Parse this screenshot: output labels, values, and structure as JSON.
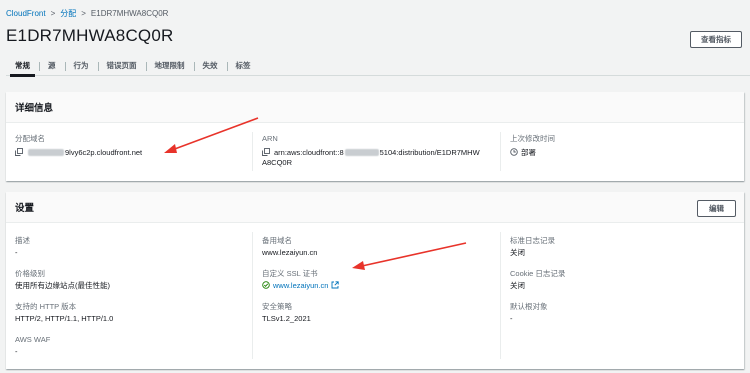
{
  "breadcrumb": {
    "root": "CloudFront",
    "section": "分配",
    "current": "E1DR7MHWA8CQ0R"
  },
  "page": {
    "title": "E1DR7MHWA8CQ0R",
    "metrics_button": "查看指标"
  },
  "tabs": [
    {
      "label": "常规",
      "active": true
    },
    {
      "label": "源"
    },
    {
      "label": "行为"
    },
    {
      "label": "错误页面"
    },
    {
      "label": "地理限制"
    },
    {
      "label": "失效"
    },
    {
      "label": "标签"
    }
  ],
  "details": {
    "title": "详细信息",
    "domain_label": "分配域名",
    "domain_value": "9lvy6c2p.cloudfront.net",
    "arn_label": "ARN",
    "arn_prefix": "arn:aws:cloudfront::8",
    "arn_suffix": "5104:distribution/E1DR7MHW",
    "arn_line2": "A8CQ0R",
    "modified_label": "上次修改时间",
    "modified_value": "部署"
  },
  "settings": {
    "title": "设置",
    "edit_button": "编辑",
    "description_label": "描述",
    "description_value": "-",
    "price_label": "价格级别",
    "price_value": "使用所有边缘站点(最佳性能)",
    "http_label": "支持的 HTTP 版本",
    "http_value": "HTTP/2, HTTP/1.1, HTTP/1.0",
    "waf_label": "AWS WAF",
    "waf_value": "-",
    "alt_domain_label": "备用域名",
    "alt_domain_value": "www.lezaiyun.cn",
    "ssl_label": "自定义 SSL 证书",
    "ssl_value": "www.lezaiyun.cn",
    "policy_label": "安全策略",
    "policy_value": "TLSv1.2_2021",
    "std_log_label": "标准日志记录",
    "std_log_value": "关闭",
    "cookie_log_label": "Cookie 日志记录",
    "cookie_log_value": "关闭",
    "default_root_label": "默认根对象",
    "default_root_value": "-"
  },
  "colors": {
    "link": "#0073bb",
    "annotation_arrow": "#e8332a",
    "success": "#1d8102"
  }
}
